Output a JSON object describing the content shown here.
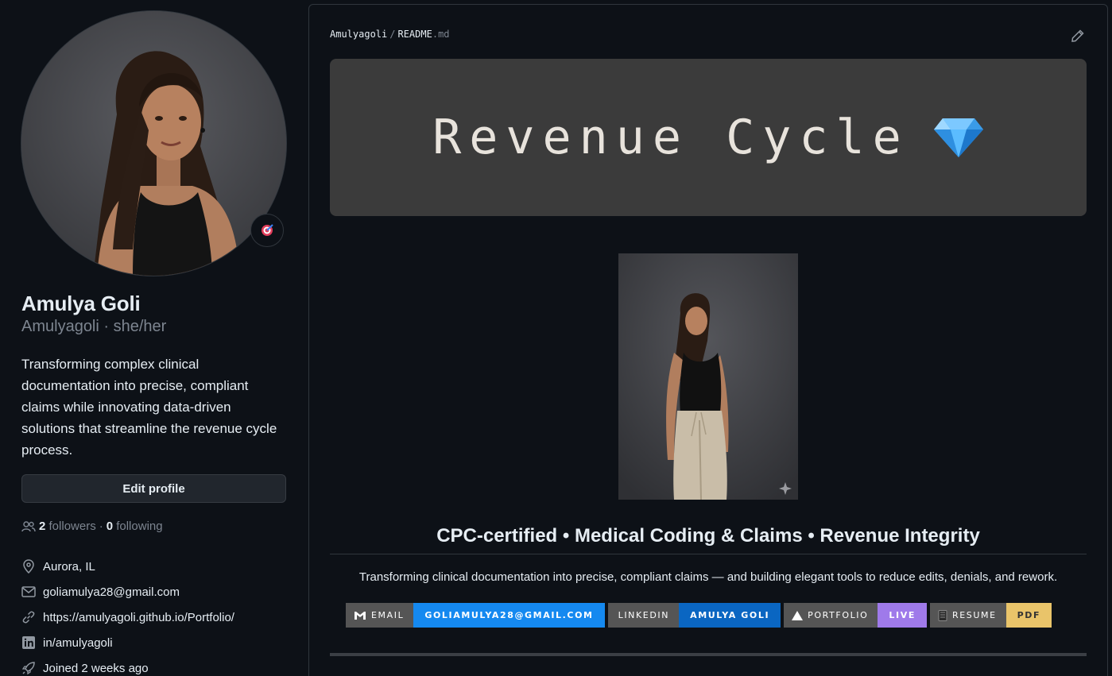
{
  "profile": {
    "name": "Amulya Goli",
    "handle": "Amulyagoli · she/her",
    "bio": "Transforming complex clinical documentation into precise, compliant claims while innovating data-driven solutions that streamline the revenue cycle process.",
    "edit_button": "Edit profile",
    "followers_count": "2",
    "followers_label": "followers",
    "following_count": "0",
    "following_label": "following",
    "location": "Aurora, IL",
    "email": "goliamulya28@gmail.com",
    "website": "https://amulyagoli.github.io/Portfolio/",
    "linkedin": "in/amulyagoli",
    "joined": "Joined 2 weeks ago",
    "status_icon": "target-emoji-icon"
  },
  "readme": {
    "owner": "Amulyagoli",
    "separator": "/",
    "file": "README",
    "ext": ".md",
    "banner_text": "Revenue Cycle",
    "banner_emoji": "gem-icon",
    "tagline": "CPC-certified • Medical Coding & Claims • Revenue Integrity",
    "subtagline": "Transforming clinical documentation into precise, compliant claims — and building elegant tools to reduce edits, denials, and rework.",
    "badges": [
      {
        "label": "EMAIL",
        "value": "GOLIAMULYA28@GMAIL.COM",
        "icon": "gmail-icon",
        "color": "#1589f0"
      },
      {
        "label": "LINKEDIN",
        "value": "AMULYA GOLI",
        "icon": "",
        "color": "#0a66c2"
      },
      {
        "label": "PORTFOLIO",
        "value": "LIVE",
        "icon": "vercel-icon",
        "color": "#9f7aea"
      },
      {
        "label": "RESUME",
        "value": "PDF",
        "icon": "readme-icon",
        "color": "#e9c46a"
      }
    ]
  },
  "colors": {
    "background": "#0d1117",
    "border": "#30363d",
    "muted": "#7d8590",
    "banner_bg": "#3b3b3b"
  }
}
